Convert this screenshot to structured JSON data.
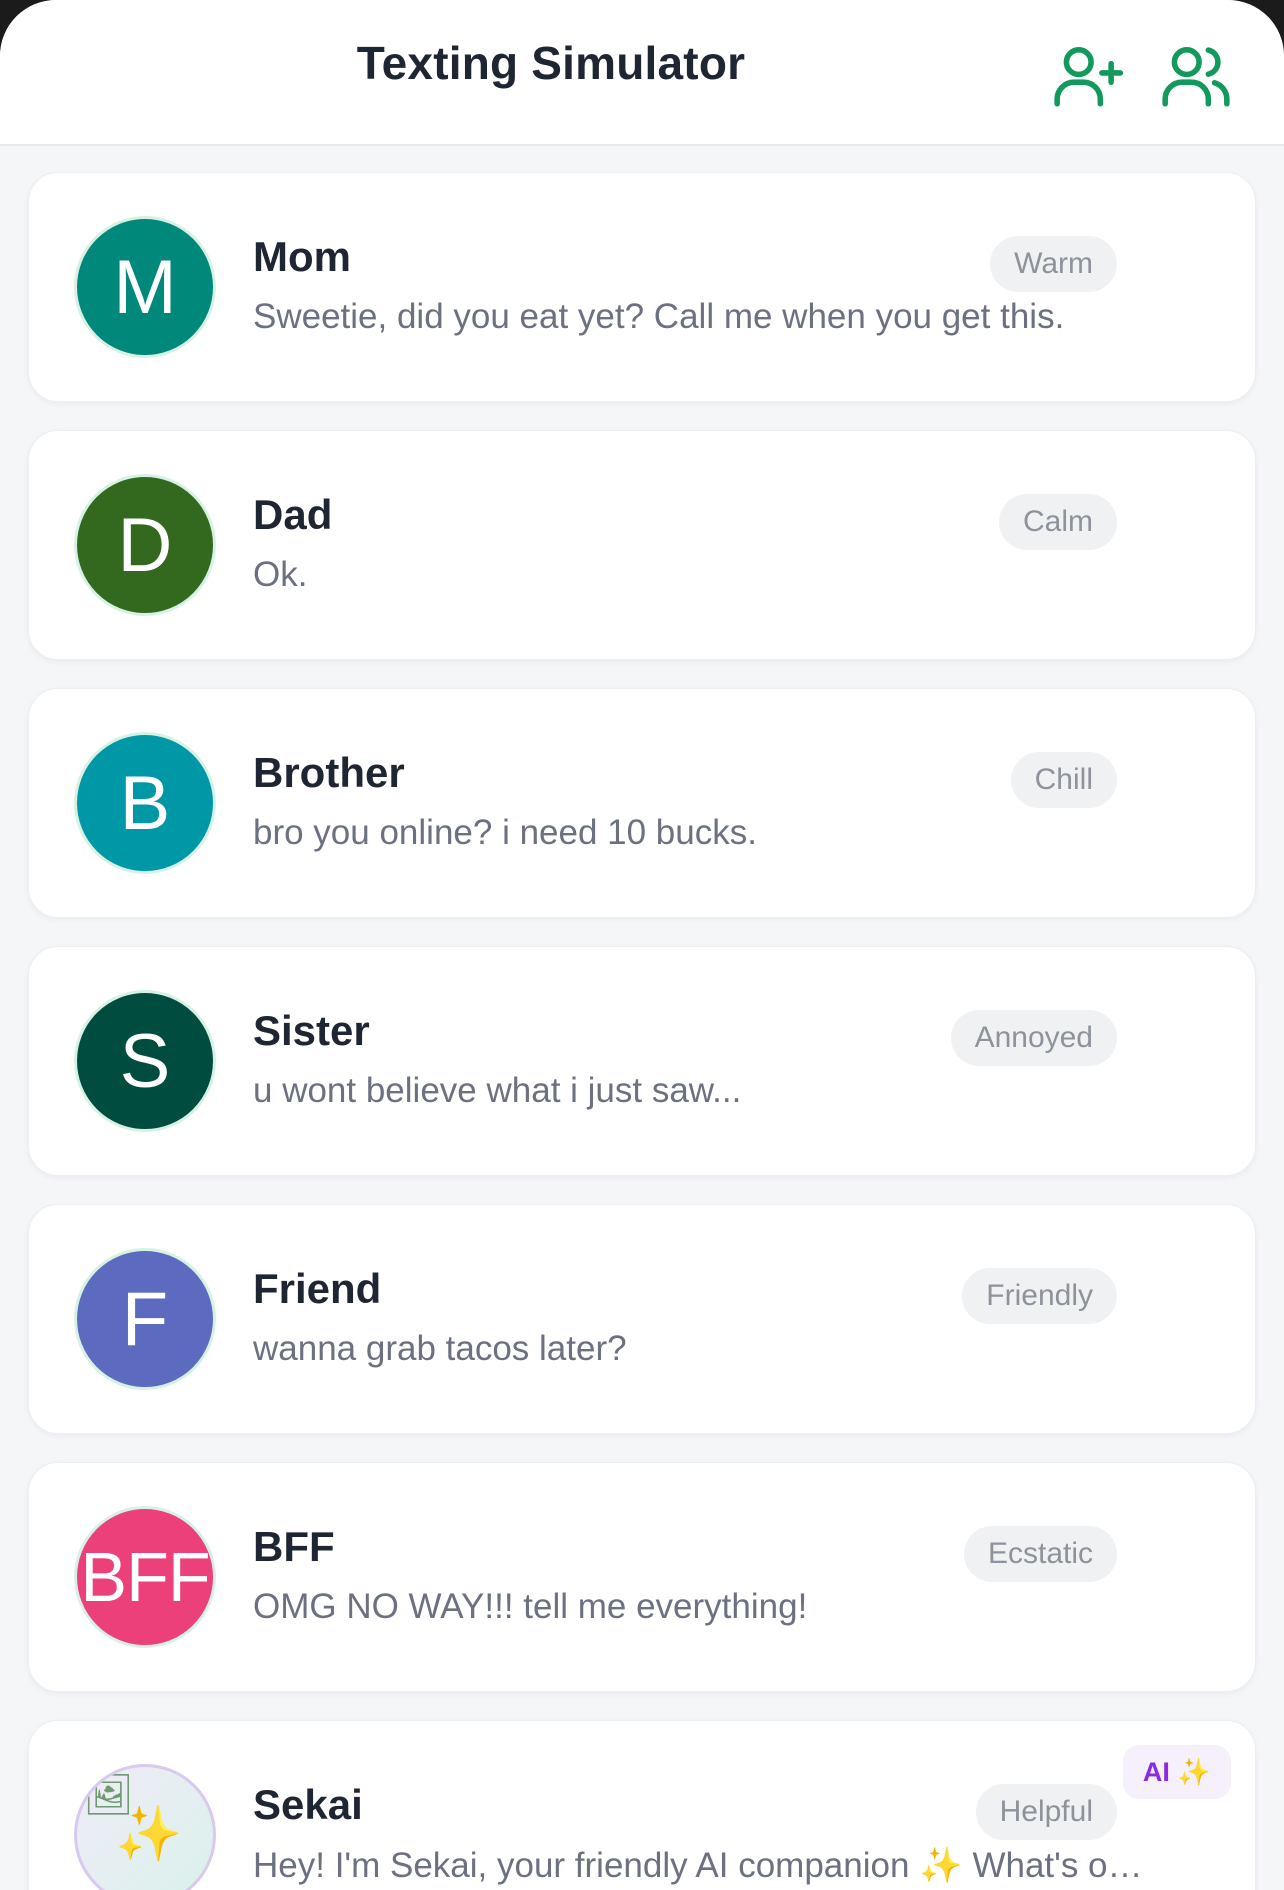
{
  "header": {
    "title": "Texting Simulator",
    "add_contact_icon": "user-plus-icon",
    "contacts_icon": "users-icon",
    "accent": "#119a5c"
  },
  "contacts": [
    {
      "initial": "M",
      "name": "Mom",
      "preview": "Sweetie, did you eat yet? Call me when you get this.",
      "mood": "Warm",
      "color": "#00897b"
    },
    {
      "initial": "D",
      "name": "Dad",
      "preview": "Ok.",
      "mood": "Calm",
      "color": "#33691e"
    },
    {
      "initial": "B",
      "name": "Brother",
      "preview": "bro you online? i need 10 bucks.",
      "mood": "Chill",
      "color": "#0097a7"
    },
    {
      "initial": "S",
      "name": "Sister",
      "preview": "u wont believe what i just saw...",
      "mood": "Annoyed",
      "color": "#004d40"
    },
    {
      "initial": "F",
      "name": "Friend",
      "preview": "wanna grab tacos later?",
      "mood": "Friendly",
      "color": "#5c6bc0"
    },
    {
      "initial": "BFF",
      "name": "BFF",
      "preview": "OMG NO WAY!!! tell me everything!",
      "mood": "Ecstatic",
      "color": "#ec407a"
    },
    {
      "initial": "✨",
      "name": "Sekai",
      "preview": "Hey! I'm Sekai, your friendly AI companion ✨ What's on your mind today?",
      "mood": "Helpful",
      "badge": "AI ✨",
      "is_ai": true
    }
  ]
}
